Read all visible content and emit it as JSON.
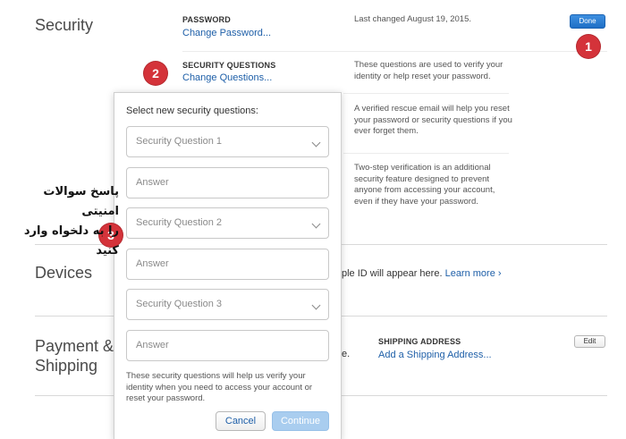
{
  "security": {
    "title": "Security",
    "password_label": "PASSWORD",
    "change_password": "Change Password...",
    "password_status": "Last changed August 19, 2015.",
    "done": "Done",
    "questions_label": "SECURITY QUESTIONS",
    "change_questions": "Change Questions...",
    "questions_desc": "These questions are used to verify your identity or help reset your password.",
    "rescue_desc": "A verified rescue email will help you reset your password or security questions if you ever forget them.",
    "twostep_desc": "Two-step verification is an additional security feature designed to prevent anyone from accessing your account, even if they have your password."
  },
  "devices": {
    "title": "Devices",
    "partial_text": "ple ID will appear here.",
    "learn_more": "Learn more ›"
  },
  "payment": {
    "title": "Payment & Shipping",
    "partial_text": "e.",
    "shipping_label": "SHIPPING ADDRESS",
    "add_shipping": "Add a Shipping Address...",
    "edit": "Edit"
  },
  "modal": {
    "heading": "Select new security questions:",
    "q1_placeholder": "Security Question 1",
    "a1_placeholder": "Answer",
    "q2_placeholder": "Security Question 2",
    "a2_placeholder": "Answer",
    "q3_placeholder": "Security Question 3",
    "a3_placeholder": "Answer",
    "note": "These security questions will help us verify your identity when you need to access your account or reset your password.",
    "cancel": "Cancel",
    "continue": "Continue"
  },
  "annotations": {
    "step1": "1",
    "step2": "2",
    "step3": "3",
    "persian_line1": "پاسخ سوالات امنیتی",
    "persian_line2": "را به دلخواه وارد کنید"
  },
  "colors": {
    "link": "#1e5fa8",
    "primary_button": "#2a7fd4",
    "marker": "#d4333a"
  }
}
